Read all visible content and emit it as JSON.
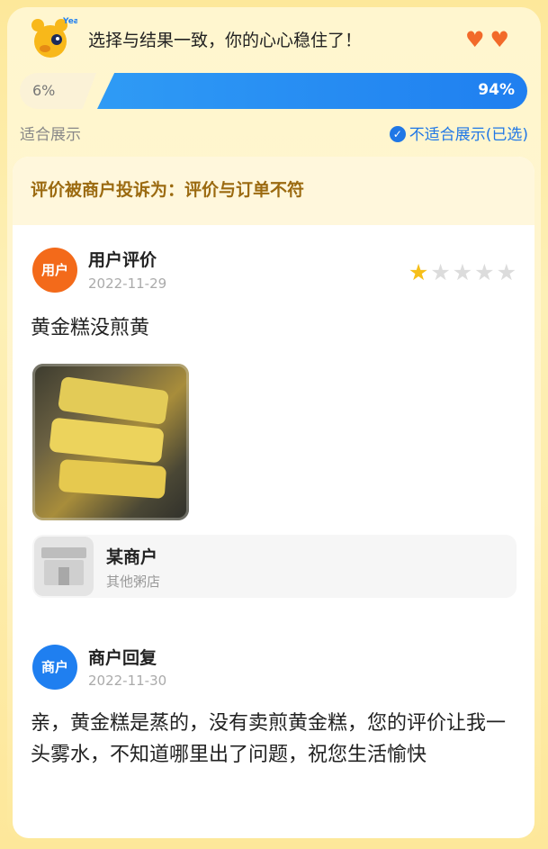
{
  "header": {
    "title": "选择与结果一致，你的心心稳住了！",
    "mascot_label": "Yeah",
    "hearts": [
      "♥",
      "♥"
    ]
  },
  "vote_bar": {
    "left_percent": "6%",
    "right_percent": "94%",
    "left_share": 0.06,
    "right_share": 0.94,
    "accent_color": "#1f7ff0"
  },
  "options": {
    "suitable": "适合展示",
    "unsuitable": "不适合展示(已选)",
    "check_icon": "✓"
  },
  "complaint": {
    "text": "评价被商户投诉为：评价与订单不符"
  },
  "user_review": {
    "badge": "用户",
    "author": "用户评价",
    "date": "2022-11-29",
    "rating": 1,
    "max_rating": 5,
    "stars": [
      "★",
      "★",
      "★",
      "★",
      "★"
    ],
    "text": "黄金糕没煎黄"
  },
  "shop": {
    "name": "某商户",
    "type": "其他粥店"
  },
  "merchant_reply": {
    "badge": "商户",
    "author": "商户回复",
    "date": "2022-11-30",
    "text": "亲，黄金糕是蒸的，没有卖煎黄金糕，您的评价让我一头雾水，不知道哪里出了问题，祝您生活愉快"
  }
}
